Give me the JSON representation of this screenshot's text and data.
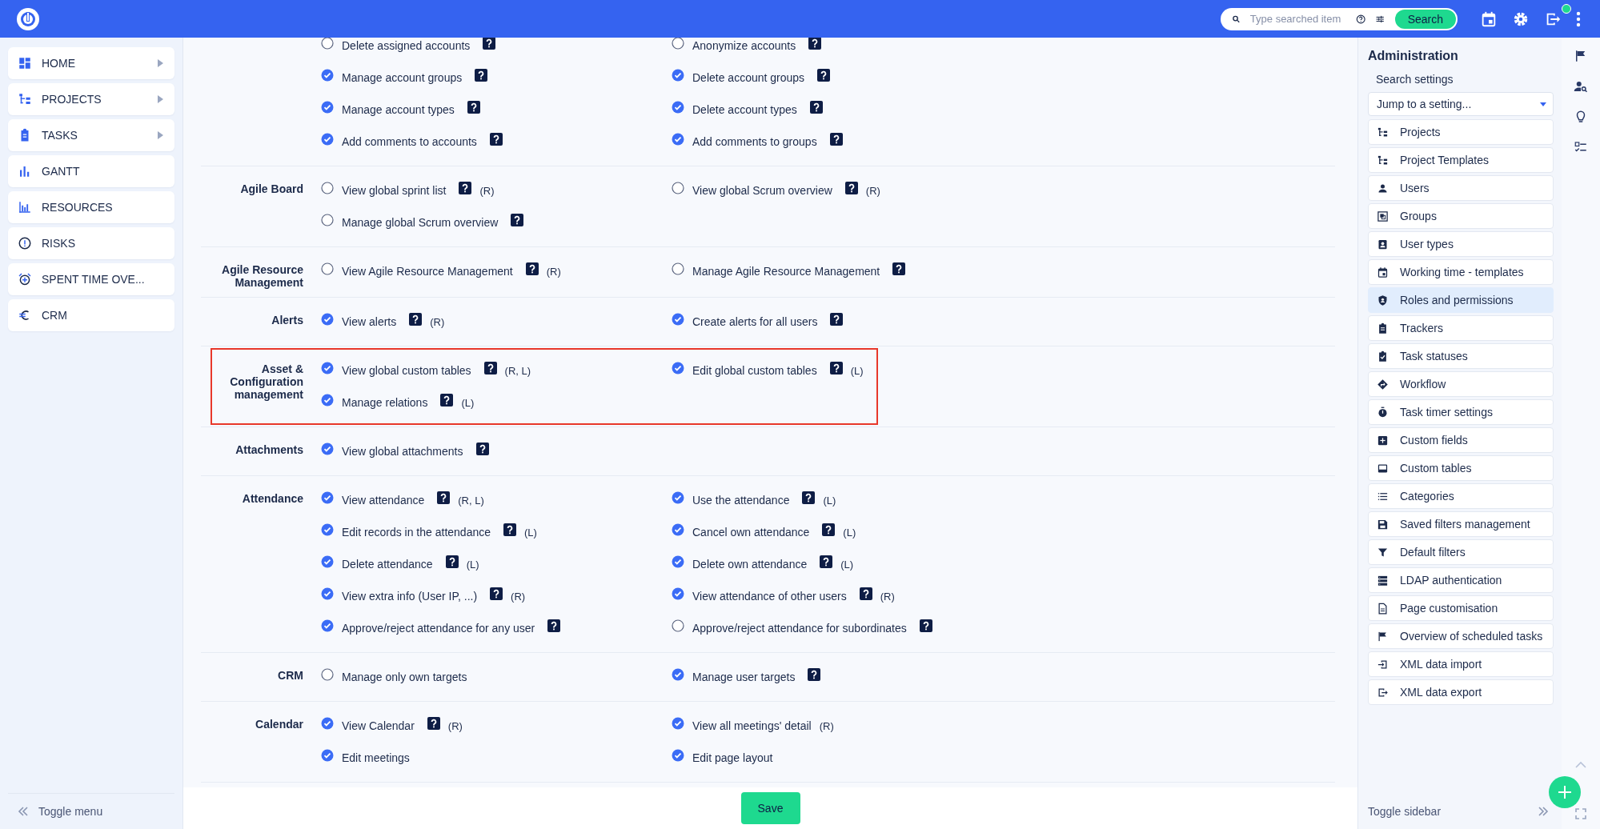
{
  "top_bar": {
    "search": {
      "placeholder": "Type searched item"
    },
    "search_button": "Search",
    "notification_dot": true
  },
  "nav": {
    "items": [
      {
        "label": "HOME",
        "has_submenu": true
      },
      {
        "label": "PROJECTS",
        "has_submenu": true
      },
      {
        "label": "TASKS",
        "has_submenu": true
      },
      {
        "label": "GANTT",
        "has_submenu": false
      },
      {
        "label": "RESOURCES",
        "has_submenu": false
      },
      {
        "label": "RISKS",
        "has_submenu": false
      },
      {
        "label": "SPENT TIME OVE...",
        "has_submenu": false
      },
      {
        "label": "CRM",
        "has_submenu": false
      }
    ],
    "toggle": "Toggle menu"
  },
  "sections": [
    {
      "highlighted": false,
      "left": [
        {
          "label": "Delete assigned accounts",
          "checked": false,
          "help": true
        },
        {
          "label": "Manage account groups",
          "checked": true,
          "help": true
        },
        {
          "label": "Manage account types",
          "checked": true,
          "help": true
        },
        {
          "label": "Add comments to accounts",
          "checked": true,
          "help": true
        }
      ],
      "right": [
        {
          "label": "Anonymize accounts",
          "checked": false,
          "help": true
        },
        {
          "label": "Delete account groups",
          "checked": true,
          "help": true
        },
        {
          "label": "Delete account types",
          "checked": true,
          "help": true
        },
        {
          "label": "Add comments to groups",
          "checked": true,
          "help": true
        }
      ]
    },
    {
      "title": "Agile Board",
      "highlighted": false,
      "left": [
        {
          "label": "View global sprint list",
          "checked": false,
          "help": true,
          "note": "(R)"
        },
        {
          "label": "Manage global Scrum overview",
          "checked": false,
          "help": true
        }
      ],
      "right": [
        {
          "label": "View global Scrum overview",
          "checked": false,
          "help": true,
          "note": "(R)"
        }
      ]
    },
    {
      "title": "Agile Resource Management",
      "highlighted": false,
      "left": [
        {
          "label": "View Agile Resource Management",
          "checked": false,
          "help": true,
          "note": "(R)"
        }
      ],
      "right": [
        {
          "label": "Manage Agile Resource Management",
          "checked": false,
          "help": true
        }
      ]
    },
    {
      "title": "Alerts",
      "highlighted": false,
      "left": [
        {
          "label": "View alerts",
          "checked": true,
          "help": true,
          "note": "(R)"
        }
      ],
      "right": [
        {
          "label": "Create alerts for all users",
          "checked": true,
          "help": true
        }
      ]
    },
    {
      "title": "Asset & Configuration management",
      "highlighted": true,
      "left": [
        {
          "label": "View global custom tables",
          "checked": true,
          "help": true,
          "note": "(R, L)"
        },
        {
          "label": "Manage relations",
          "checked": true,
          "help": true,
          "note": "(L)"
        }
      ],
      "right": [
        {
          "label": "Edit global custom tables",
          "checked": true,
          "help": true,
          "note": "(L)"
        }
      ]
    },
    {
      "title": "Attachments",
      "highlighted": false,
      "left": [
        {
          "label": "View global attachments",
          "checked": true,
          "help": true
        }
      ]
    },
    {
      "title": "Attendance",
      "highlighted": false,
      "left": [
        {
          "label": "View attendance",
          "checked": true,
          "help": true,
          "note": "(R, L)"
        },
        {
          "label": "Edit records in the attendance",
          "checked": true,
          "help": true,
          "note": "(L)"
        },
        {
          "label": "Delete attendance",
          "checked": true,
          "help": true,
          "note": "(L)"
        },
        {
          "label": "View extra info (User IP, ...)",
          "checked": true,
          "help": true,
          "note": "(R)"
        },
        {
          "label": "Approve/reject attendance for any user",
          "checked": true,
          "help": true
        }
      ],
      "right": [
        {
          "label": "Use the attendance",
          "checked": true,
          "help": true,
          "note": "(L)"
        },
        {
          "label": "Cancel own attendance",
          "checked": true,
          "help": true,
          "note": "(L)"
        },
        {
          "label": "Delete own attendance",
          "checked": true,
          "help": true,
          "note": "(L)"
        },
        {
          "label": "View attendance of other users",
          "checked": true,
          "help": true,
          "note": "(R)"
        },
        {
          "label": "Approve/reject attendance for subordinates",
          "checked": false,
          "help": true
        }
      ]
    },
    {
      "title": "CRM",
      "highlighted": false,
      "left": [
        {
          "label": "Manage only own targets",
          "checked": false,
          "help": false
        }
      ],
      "right": [
        {
          "label": "Manage user targets",
          "checked": true,
          "help": true
        }
      ]
    },
    {
      "title": "Calendar",
      "highlighted": false,
      "left": [
        {
          "label": "View Calendar",
          "checked": true,
          "help": true,
          "note": "(R)"
        },
        {
          "label": "Edit meetings",
          "checked": true,
          "help": false
        }
      ],
      "right": [
        {
          "label": "View all meetings' detail",
          "checked": true,
          "help": false,
          "note": "(R)"
        },
        {
          "label": "Edit page layout",
          "checked": true,
          "help": false
        }
      ]
    }
  ],
  "save_button": "Save",
  "admin": {
    "title": "Administration",
    "search_label": "Search settings",
    "jump": "Jump to a setting...",
    "items": [
      {
        "label": "Projects",
        "selected": false
      },
      {
        "label": "Project Templates",
        "selected": false
      },
      {
        "label": "Users",
        "selected": false
      },
      {
        "label": "Groups",
        "selected": false
      },
      {
        "label": "User types",
        "selected": false
      },
      {
        "label": "Working time - templates",
        "selected": false
      },
      {
        "label": "Roles and permissions",
        "selected": true
      },
      {
        "label": "Trackers",
        "selected": false
      },
      {
        "label": "Task statuses",
        "selected": false
      },
      {
        "label": "Workflow",
        "selected": false
      },
      {
        "label": "Task timer settings",
        "selected": false
      },
      {
        "label": "Custom fields",
        "selected": false
      },
      {
        "label": "Custom tables",
        "selected": false
      },
      {
        "label": "Categories",
        "selected": false
      },
      {
        "label": "Saved filters management",
        "selected": false
      },
      {
        "label": "Default filters",
        "selected": false
      },
      {
        "label": "LDAP authentication",
        "selected": false
      },
      {
        "label": "Page customisation",
        "selected": false
      },
      {
        "label": "Overview of scheduled tasks",
        "selected": false
      },
      {
        "label": "XML data import",
        "selected": false
      },
      {
        "label": "XML data export",
        "selected": false
      }
    ],
    "toggle": "Toggle sidebar"
  }
}
